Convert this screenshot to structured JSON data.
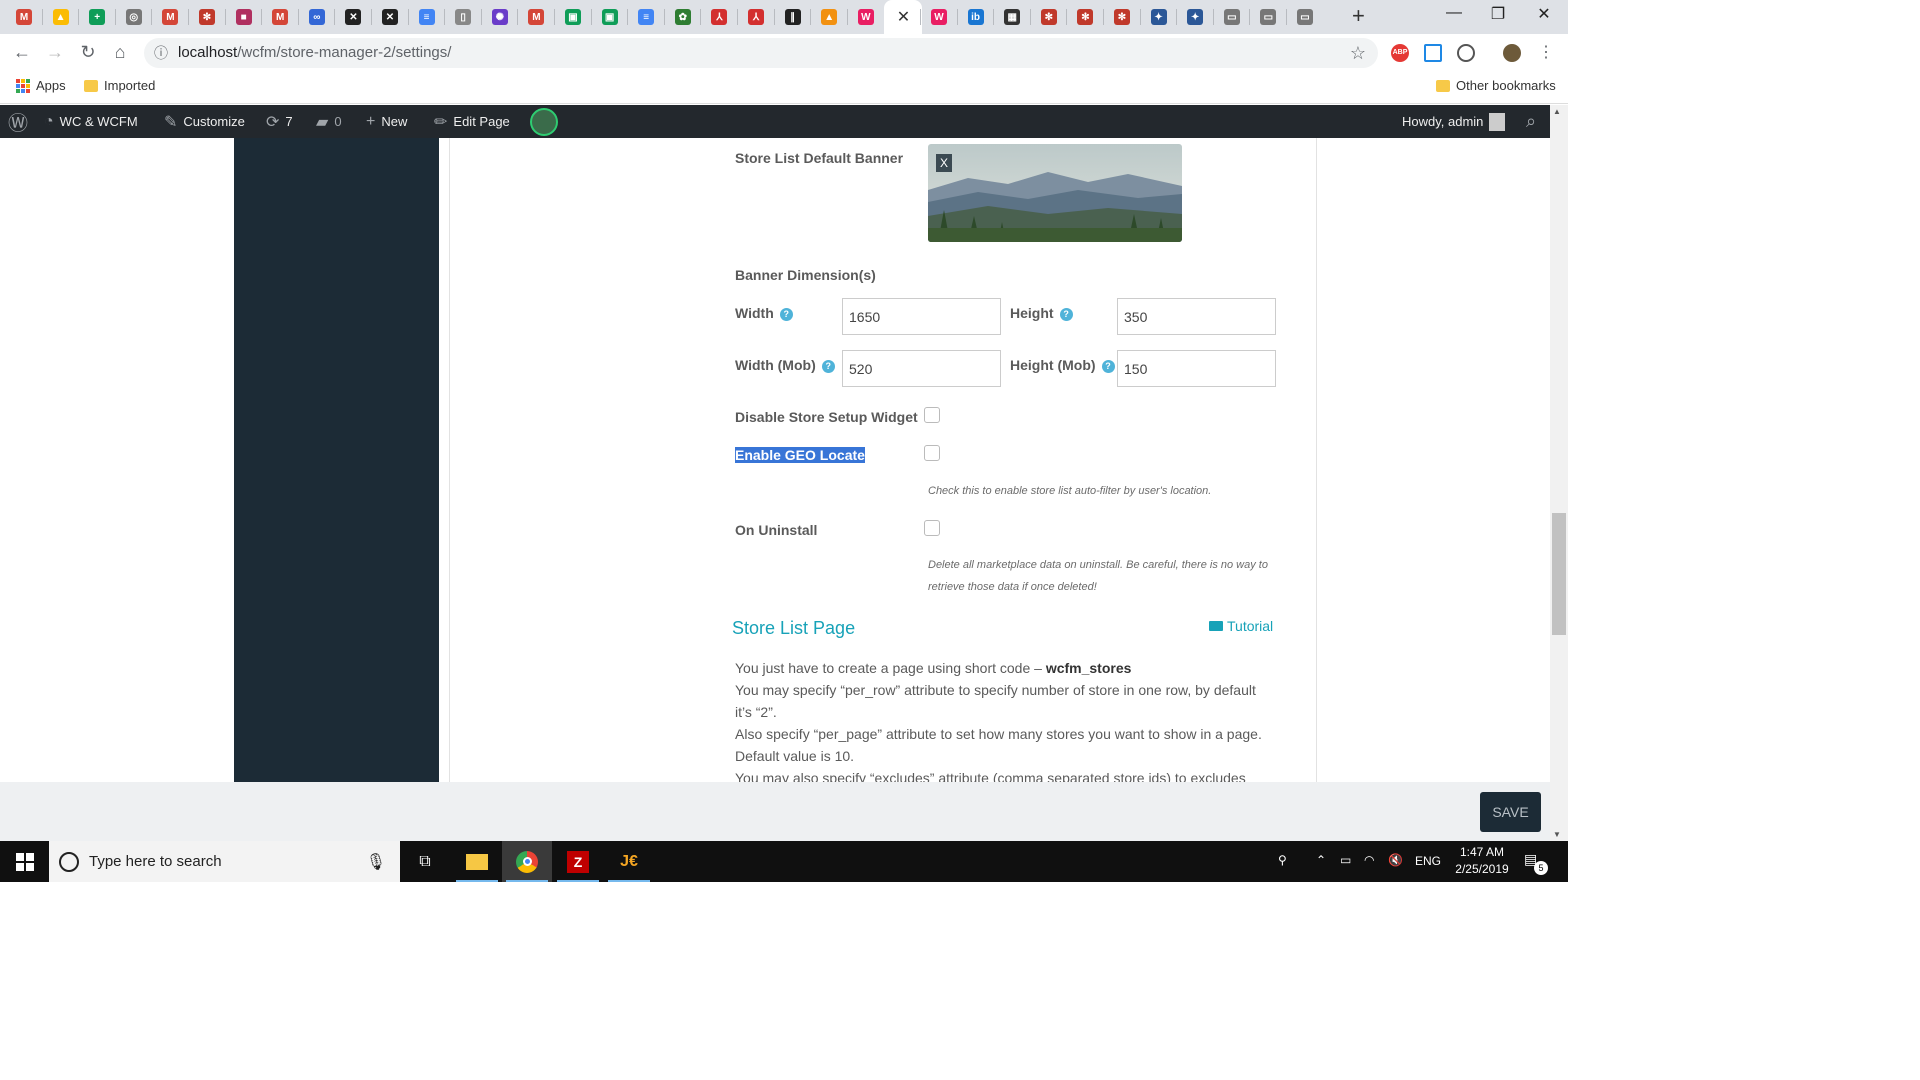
{
  "browser": {
    "tabs": [
      {
        "icon": "gmail-icon",
        "color": "#d44638",
        "glyph": "M"
      },
      {
        "icon": "drive-icon",
        "color": "#fbbc04",
        "glyph": "▲"
      },
      {
        "icon": "sheets-icon",
        "color": "#0f9d58",
        "glyph": "+"
      },
      {
        "icon": "generic-icon",
        "color": "#777777",
        "glyph": "◎"
      },
      {
        "icon": "gmail-icon",
        "color": "#d44638",
        "glyph": "M"
      },
      {
        "icon": "wcfm-icon",
        "color": "#c0392b",
        "glyph": "✻"
      },
      {
        "icon": "screen-icon",
        "color": "#b03060",
        "glyph": "■"
      },
      {
        "icon": "gmail-icon",
        "color": "#d44638",
        "glyph": "M"
      },
      {
        "icon": "link-icon",
        "color": "#3367d6",
        "glyph": "∞"
      },
      {
        "icon": "close-badge-icon",
        "color": "#222222",
        "glyph": "✕"
      },
      {
        "icon": "close-badge-icon",
        "color": "#222222",
        "glyph": "✕"
      },
      {
        "icon": "docs-icon",
        "color": "#4285f4",
        "glyph": "≡"
      },
      {
        "icon": "file-icon",
        "color": "#888888",
        "glyph": "▯"
      },
      {
        "icon": "globe-icon",
        "color": "#6a3cc9",
        "glyph": "✺"
      },
      {
        "icon": "gmail-icon",
        "color": "#d44638",
        "glyph": "M"
      },
      {
        "icon": "chat-icon",
        "color": "#0f9d58",
        "glyph": "▣"
      },
      {
        "icon": "chat-icon",
        "color": "#0f9d58",
        "glyph": "▣"
      },
      {
        "icon": "docs-icon",
        "color": "#4285f4",
        "glyph": "≡"
      },
      {
        "icon": "leaf-icon",
        "color": "#2e7d32",
        "glyph": "✿"
      },
      {
        "icon": "pdf-icon",
        "color": "#d32f2f",
        "glyph": "⅄"
      },
      {
        "icon": "pdf-icon",
        "color": "#d32f2f",
        "glyph": "⅄"
      },
      {
        "icon": "stripe-icon",
        "color": "#222222",
        "glyph": "∥"
      },
      {
        "icon": "pma-icon",
        "color": "#f29111",
        "glyph": "▲"
      },
      {
        "icon": "wcfm-icon",
        "color": "#e91e63",
        "glyph": "W"
      },
      {
        "icon": "active-tab",
        "color": "#ffffff",
        "glyph": "✕"
      },
      {
        "icon": "wcfm-icon",
        "color": "#e91e63",
        "glyph": "W"
      },
      {
        "icon": "ibb-icon",
        "color": "#1976d2",
        "glyph": "ib"
      },
      {
        "icon": "film-icon",
        "color": "#333333",
        "glyph": "▦"
      },
      {
        "icon": "wcfm-icon",
        "color": "#c0392b",
        "glyph": "✻"
      },
      {
        "icon": "wcfm-icon",
        "color": "#c0392b",
        "glyph": "✻"
      },
      {
        "icon": "wcfm-icon",
        "color": "#c0392b",
        "glyph": "✻"
      },
      {
        "icon": "tools-icon",
        "color": "#2b5797",
        "glyph": "✦"
      },
      {
        "icon": "tools-icon",
        "color": "#2b5797",
        "glyph": "✦"
      },
      {
        "icon": "monitor-icon",
        "color": "#777777",
        "glyph": "▭"
      },
      {
        "icon": "monitor-icon",
        "color": "#777777",
        "glyph": "▭"
      },
      {
        "icon": "monitor-icon",
        "color": "#777777",
        "glyph": "▭"
      }
    ],
    "url_host": "localhost",
    "url_path": "/wcfm/store-manager-2/settings/",
    "bookmarks": {
      "apps": "Apps",
      "imported": "Imported",
      "other": "Other bookmarks"
    }
  },
  "wp_admin_bar": {
    "site": "WC & WCFM",
    "customize": "Customize",
    "updates": "7",
    "comments": "0",
    "new": "New",
    "edit_page": "Edit Page",
    "howdy": "Howdy, admin"
  },
  "settings": {
    "banner_label": "Store List Default Banner",
    "banner_remove": "X",
    "dimensions_label": "Banner Dimension(s)",
    "width_label": "Width",
    "width_value": "1650",
    "height_label": "Height",
    "height_value": "350",
    "width_mob_label": "Width (Mob)",
    "width_mob_value": "520",
    "height_mob_label": "Height (Mob)",
    "height_mob_value": "150",
    "disable_widget_label": "Disable Store Setup Widget",
    "geo_label": "Enable GEO Locate",
    "geo_desc": "Check this to enable store list auto-filter by user's location.",
    "uninstall_label": "On Uninstall",
    "uninstall_desc_1": "Delete all marketplace data on uninstall. Be careful, there is no way to",
    "uninstall_desc_2": "retrieve those data if once deleted!",
    "store_list_title": "Store List Page",
    "tutorial": "Tutorial",
    "para1_text": "You just have to create a page using short code – ",
    "para1_code": "wcfm_stores",
    "para2": "You may specify “per_row” attribute to specify number of store in one row, by default it’s “2”.",
    "para3": "Also specify “per_page” attribute to set how many stores you want to show in a page. Default value is 10.",
    "para4": "You may also specify “excludes” attribute (comma separated store ids) to excludes some"
  },
  "footer": {
    "save": "SAVE"
  },
  "taskbar": {
    "search_placeholder": "Type here to search",
    "lang": "ENG",
    "time": "1:47 AM",
    "date": "2/25/2019",
    "notifications": "5"
  }
}
